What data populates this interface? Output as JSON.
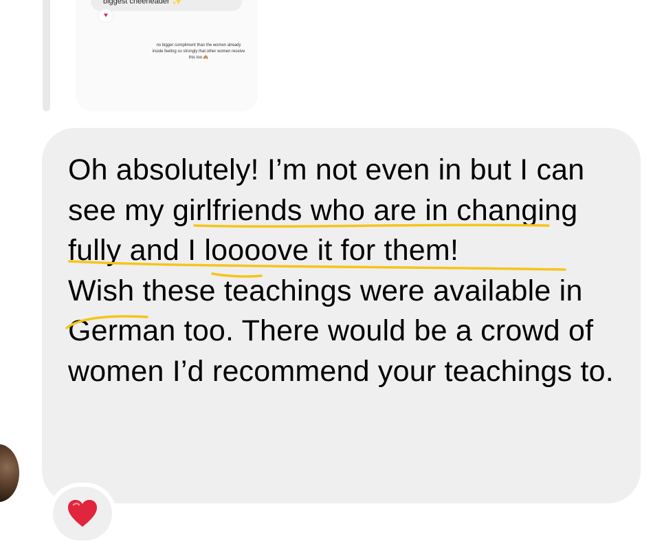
{
  "story_reply": {
    "top_text": "biggest cheerleader",
    "top_emoji": "✨",
    "reaction_emoji": "♥",
    "caption": "no bigger compliment than the women already inside feeling so strongly that other women receive this too",
    "caption_emoji": "🙈"
  },
  "message": {
    "paragraph1": "Oh absolutely! I’m not even in but I can see my girlfriends who are in changing fully and I loooove it for them!",
    "paragraph2": "Wish these teachings were available in German too. There would be a crowd of women I’d recommend your teachings to."
  },
  "reaction": {
    "emoji": "❤️",
    "color": "#e0253d"
  },
  "colors": {
    "bubble": "#efefef",
    "highlight": "#f5c518"
  }
}
